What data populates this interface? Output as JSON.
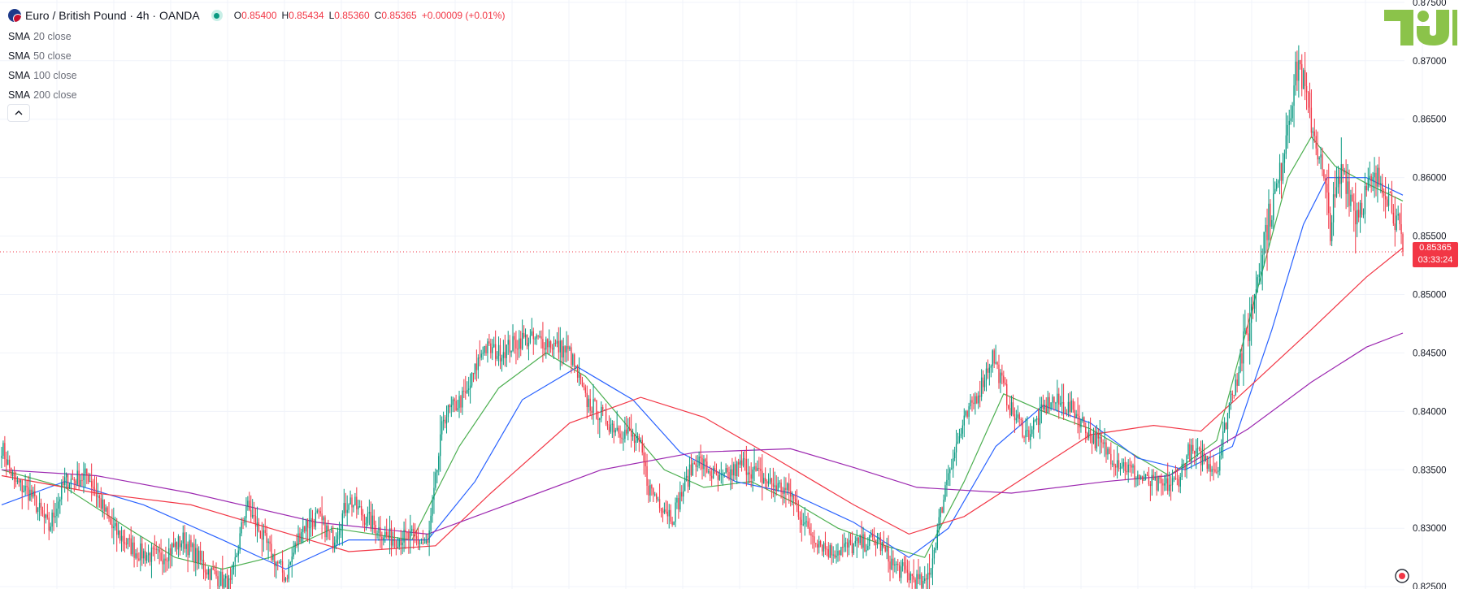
{
  "header": {
    "symbol": "Euro / British Pound · 4h · OANDA",
    "o_label": "O",
    "o_value": "0.85400",
    "h_label": "H",
    "h_value": "0.85434",
    "l_label": "L",
    "l_value": "0.85360",
    "c_label": "C",
    "c_value": "0.85365",
    "change": "+0.00009 (+0.01%)"
  },
  "legend": [
    {
      "name": "SMA",
      "params": "20 close"
    },
    {
      "name": "SMA",
      "params": "50 close"
    },
    {
      "name": "SMA",
      "params": "100 close"
    },
    {
      "name": "SMA",
      "params": "200 close"
    }
  ],
  "last_price": {
    "value": "0.85365",
    "countdown": "03:33:24"
  },
  "colors": {
    "up": "#089981",
    "down": "#f23645",
    "sma20": "#4caf50",
    "sma50": "#2962ff",
    "sma100": "#f23645",
    "sma200": "#9c27b0",
    "grid": "#f0f3fa",
    "logo": "#8bc34a"
  },
  "icons": {
    "collapse": "chevron-up-icon",
    "logo": "tv-logo-icon",
    "flag": "eur-gbp-flag-icon"
  },
  "chart_data": {
    "type": "candlestick",
    "ylim": [
      0.8248,
      0.8752
    ],
    "yticks": [
      0.825,
      0.83,
      0.835,
      0.84,
      0.845,
      0.85,
      0.855,
      0.86,
      0.865,
      0.87,
      0.875
    ],
    "ytick_labels": [
      "0.82500",
      "0.83000",
      "0.83500",
      "0.84000",
      "0.84500",
      "0.85000",
      "0.85500",
      "0.86000",
      "0.86500",
      "0.87000",
      "0.87500"
    ],
    "grid": true,
    "close_path": [
      [
        0,
        0.837
      ],
      [
        8,
        0.834
      ],
      [
        18,
        0.833
      ],
      [
        30,
        0.83
      ],
      [
        40,
        0.834
      ],
      [
        55,
        0.8345
      ],
      [
        70,
        0.83
      ],
      [
        85,
        0.828
      ],
      [
        100,
        0.8275
      ],
      [
        115,
        0.829
      ],
      [
        130,
        0.8265
      ],
      [
        145,
        0.825
      ],
      [
        155,
        0.832
      ],
      [
        170,
        0.828
      ],
      [
        180,
        0.8258
      ],
      [
        190,
        0.83
      ],
      [
        200,
        0.831
      ],
      [
        210,
        0.829
      ],
      [
        220,
        0.8325
      ],
      [
        230,
        0.831
      ],
      [
        245,
        0.8292
      ],
      [
        260,
        0.8292
      ],
      [
        270,
        0.8285
      ],
      [
        280,
        0.8395
      ],
      [
        295,
        0.8415
      ],
      [
        305,
        0.8455
      ],
      [
        315,
        0.845
      ],
      [
        330,
        0.8462
      ],
      [
        345,
        0.846
      ],
      [
        360,
        0.845
      ],
      [
        370,
        0.841
      ],
      [
        385,
        0.839
      ],
      [
        398,
        0.838
      ],
      [
        405,
        0.8368
      ],
      [
        410,
        0.8335
      ],
      [
        425,
        0.831
      ],
      [
        440,
        0.836
      ],
      [
        455,
        0.834
      ],
      [
        470,
        0.8355
      ],
      [
        485,
        0.834
      ],
      [
        500,
        0.833
      ],
      [
        510,
        0.83
      ],
      [
        525,
        0.828
      ],
      [
        540,
        0.8285
      ],
      [
        555,
        0.829
      ],
      [
        565,
        0.8268
      ],
      [
        575,
        0.826
      ],
      [
        585,
        0.825
      ],
      [
        590,
        0.8275
      ],
      [
        600,
        0.835
      ],
      [
        610,
        0.839
      ],
      [
        620,
        0.842
      ],
      [
        628,
        0.8448
      ],
      [
        640,
        0.84
      ],
      [
        650,
        0.838
      ],
      [
        665,
        0.841
      ],
      [
        680,
        0.84
      ],
      [
        690,
        0.838
      ],
      [
        705,
        0.836
      ],
      [
        715,
        0.835
      ],
      [
        725,
        0.834
      ],
      [
        735,
        0.8335
      ],
      [
        745,
        0.834
      ],
      [
        752,
        0.8365
      ],
      [
        762,
        0.836
      ],
      [
        770,
        0.835
      ],
      [
        780,
        0.842
      ],
      [
        790,
        0.847
      ],
      [
        800,
        0.855
      ],
      [
        810,
        0.86
      ],
      [
        815,
        0.865
      ],
      [
        822,
        0.87
      ],
      [
        828,
        0.866
      ],
      [
        835,
        0.862
      ],
      [
        842,
        0.856
      ],
      [
        850,
        0.861
      ],
      [
        858,
        0.857
      ],
      [
        866,
        0.859
      ],
      [
        875,
        0.86
      ],
      [
        882,
        0.8575
      ],
      [
        888,
        0.8536
      ]
    ],
    "close_path_note_x": "x = 4h bar index",
    "series": [
      {
        "name": "SMA 20 close",
        "values": [
          [
            0,
            0.835
          ],
          [
            40,
            0.8335
          ],
          [
            80,
            0.83
          ],
          [
            110,
            0.8275
          ],
          [
            140,
            0.8265
          ],
          [
            170,
            0.8275
          ],
          [
            210,
            0.83
          ],
          [
            260,
            0.829
          ],
          [
            290,
            0.837
          ],
          [
            315,
            0.842
          ],
          [
            345,
            0.845
          ],
          [
            370,
            0.843
          ],
          [
            395,
            0.839
          ],
          [
            420,
            0.835
          ],
          [
            445,
            0.8335
          ],
          [
            475,
            0.834
          ],
          [
            505,
            0.832
          ],
          [
            530,
            0.83
          ],
          [
            560,
            0.8285
          ],
          [
            585,
            0.8275
          ],
          [
            610,
            0.834
          ],
          [
            635,
            0.8415
          ],
          [
            660,
            0.84
          ],
          [
            690,
            0.8385
          ],
          [
            715,
            0.8365
          ],
          [
            740,
            0.8345
          ],
          [
            770,
            0.8375
          ],
          [
            795,
            0.85
          ],
          [
            815,
            0.86
          ],
          [
            830,
            0.8635
          ],
          [
            845,
            0.861
          ],
          [
            865,
            0.8595
          ],
          [
            888,
            0.858
          ]
        ]
      },
      {
        "name": "SMA 50 close",
        "values": [
          [
            0,
            0.832
          ],
          [
            40,
            0.834
          ],
          [
            90,
            0.832
          ],
          [
            140,
            0.829
          ],
          [
            180,
            0.8265
          ],
          [
            220,
            0.829
          ],
          [
            270,
            0.829
          ],
          [
            300,
            0.834
          ],
          [
            330,
            0.841
          ],
          [
            365,
            0.8438
          ],
          [
            400,
            0.841
          ],
          [
            430,
            0.8365
          ],
          [
            465,
            0.834
          ],
          [
            500,
            0.833
          ],
          [
            540,
            0.8305
          ],
          [
            575,
            0.8275
          ],
          [
            600,
            0.83
          ],
          [
            630,
            0.837
          ],
          [
            660,
            0.8405
          ],
          [
            690,
            0.839
          ],
          [
            720,
            0.836
          ],
          [
            750,
            0.835
          ],
          [
            780,
            0.837
          ],
          [
            805,
            0.847
          ],
          [
            825,
            0.856
          ],
          [
            840,
            0.86
          ],
          [
            865,
            0.86
          ],
          [
            888,
            0.8585
          ]
        ]
      },
      {
        "name": "SMA 100 close",
        "values": [
          [
            0,
            0.8345
          ],
          [
            60,
            0.833
          ],
          [
            120,
            0.832
          ],
          [
            170,
            0.83
          ],
          [
            220,
            0.828
          ],
          [
            275,
            0.8285
          ],
          [
            310,
            0.833
          ],
          [
            360,
            0.839
          ],
          [
            405,
            0.8412
          ],
          [
            445,
            0.8395
          ],
          [
            490,
            0.836
          ],
          [
            540,
            0.832
          ],
          [
            575,
            0.8295
          ],
          [
            610,
            0.831
          ],
          [
            650,
            0.8345
          ],
          [
            690,
            0.838
          ],
          [
            730,
            0.8388
          ],
          [
            760,
            0.8383
          ],
          [
            790,
            0.842
          ],
          [
            830,
            0.847
          ],
          [
            865,
            0.8515
          ],
          [
            888,
            0.854
          ]
        ]
      },
      {
        "name": "SMA 200 close",
        "values": [
          [
            0,
            0.835
          ],
          [
            60,
            0.8345
          ],
          [
            120,
            0.833
          ],
          [
            200,
            0.8305
          ],
          [
            270,
            0.8295
          ],
          [
            320,
            0.832
          ],
          [
            380,
            0.835
          ],
          [
            440,
            0.8365
          ],
          [
            500,
            0.8368
          ],
          [
            540,
            0.8352
          ],
          [
            580,
            0.8335
          ],
          [
            640,
            0.833
          ],
          [
            700,
            0.834
          ],
          [
            740,
            0.8345
          ],
          [
            790,
            0.8385
          ],
          [
            830,
            0.8425
          ],
          [
            865,
            0.8455
          ],
          [
            888,
            0.8467
          ]
        ]
      }
    ],
    "current_price": 0.85365
  }
}
